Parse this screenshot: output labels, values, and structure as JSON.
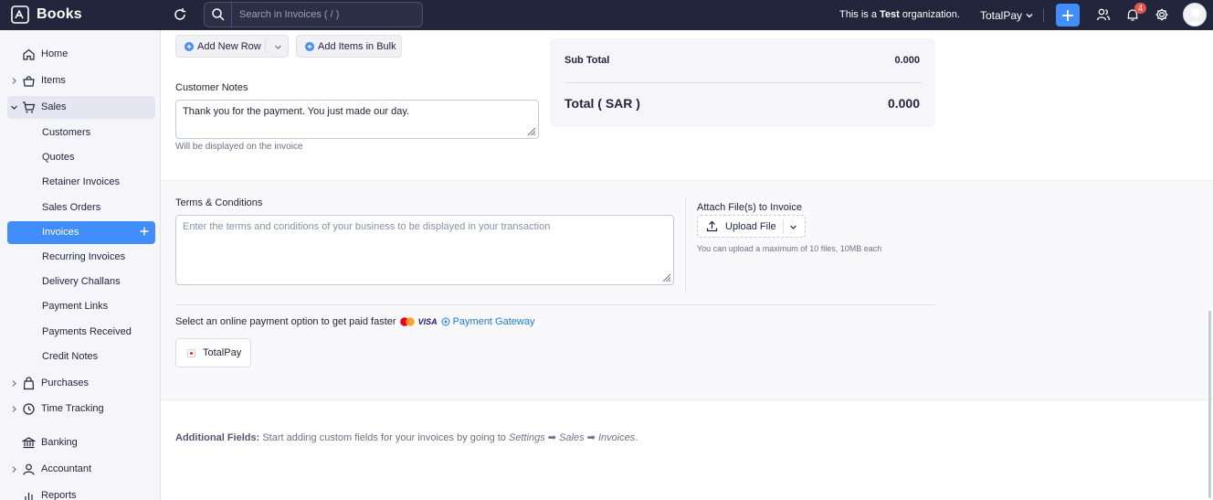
{
  "app": {
    "name": "Books"
  },
  "topbar": {
    "search_placeholder": "Search in Invoices ( / )",
    "org_note_prefix": "This is a ",
    "org_note_bold": "Test",
    "org_note_suffix": " organization.",
    "org_name": "TotalPay",
    "notification_count": "4",
    "accent": "#408dfb"
  },
  "sidebar": {
    "items": [
      {
        "label": "Home",
        "icon": "home-icon",
        "chevron": false
      },
      {
        "label": "Items",
        "icon": "basket-icon",
        "chevron": true
      },
      {
        "label": "Sales",
        "icon": "cart-icon",
        "chevron": true,
        "expanded": true
      },
      {
        "label": "Customers"
      },
      {
        "label": "Quotes"
      },
      {
        "label": "Retainer Invoices"
      },
      {
        "label": "Sales Orders"
      },
      {
        "label": "Invoices",
        "active": true
      },
      {
        "label": "Recurring Invoices"
      },
      {
        "label": "Delivery Challans"
      },
      {
        "label": "Payment Links"
      },
      {
        "label": "Payments Received"
      },
      {
        "label": "Credit Notes"
      },
      {
        "label": "Purchases",
        "icon": "bag-icon",
        "chevron": true
      },
      {
        "label": "Time Tracking",
        "icon": "clock-icon",
        "chevron": true
      },
      {
        "label": "Banking",
        "icon": "bank-icon",
        "chevron": false
      },
      {
        "label": "Accountant",
        "icon": "person-icon",
        "chevron": true
      },
      {
        "label": "Reports",
        "icon": "chart-icon",
        "chevron": false
      }
    ]
  },
  "items_actions": {
    "add_new_row": "Add New Row",
    "add_items_bulk": "Add Items in Bulk"
  },
  "customer_notes": {
    "label": "Customer Notes",
    "value": "Thank you for the payment. You just made our day.",
    "hint": "Will be displayed on the invoice"
  },
  "totals": {
    "subtotal_label": "Sub Total",
    "subtotal_value": "0.000",
    "total_label": "Total ( SAR )",
    "total_value": "0.000"
  },
  "terms": {
    "label": "Terms & Conditions",
    "placeholder": "Enter the terms and conditions of your business to be displayed in your transaction"
  },
  "attachments": {
    "label": "Attach File(s) to Invoice",
    "upload_label": "Upload File",
    "hint": "You can upload a maximum of 10 files, 10MB each"
  },
  "payment": {
    "prompt": "Select an online payment option to get paid faster",
    "card_brand": "VISA",
    "gateway_link": "Payment Gateway",
    "option_label": "TotalPay"
  },
  "additional_fields": {
    "title": "Additional Fields:",
    "text": " Start adding custom fields for your invoices by going to ",
    "path1": "Settings",
    "arrow": " ➡ ",
    "path2": "Sales",
    "path3": "Invoices",
    "end": "."
  }
}
